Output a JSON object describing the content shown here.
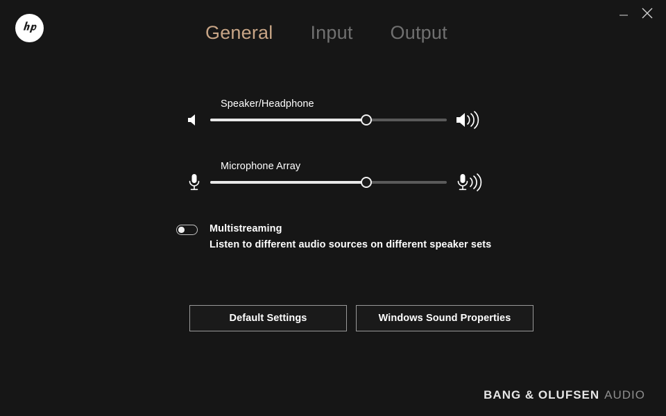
{
  "window": {
    "background_color": "#161616",
    "logo_name": "hp",
    "controls": [
      {
        "name": "minimize",
        "glyph": "minimize-icon"
      },
      {
        "name": "close",
        "glyph": "close-icon"
      }
    ]
  },
  "tabs": [
    {
      "label": "General",
      "active": true,
      "color": "#c8a586"
    },
    {
      "label": "Input",
      "active": false,
      "color": "#707070"
    },
    {
      "label": "Output",
      "active": false,
      "color": "#707070"
    }
  ],
  "sliders": [
    {
      "id": "speaker",
      "label": "Speaker/Headphone",
      "value": 66,
      "min": 0,
      "max": 100,
      "icon_left": "speaker-mute-icon",
      "icon_right": "speaker-volume-icon"
    },
    {
      "id": "microphone",
      "label": "Microphone Array",
      "value": 66,
      "min": 0,
      "max": 100,
      "icon_left": "microphone-icon",
      "icon_right": "microphone-volume-icon"
    }
  ],
  "multistreaming": {
    "title": "Multistreaming",
    "description": "Listen to different audio sources on different speaker sets",
    "enabled": false
  },
  "buttons": {
    "default_settings": "Default Settings",
    "windows_sound_properties": "Windows Sound Properties"
  },
  "branding": {
    "primary": "BANG & OLUFSEN",
    "secondary": "AUDIO"
  }
}
